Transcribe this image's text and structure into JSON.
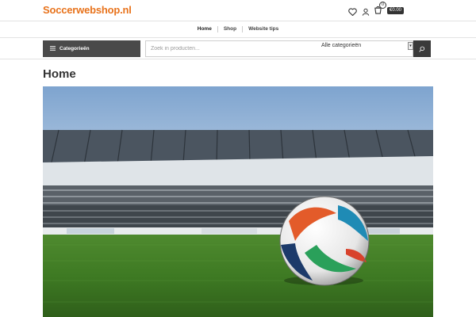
{
  "site": {
    "logo": "Soccerwebshop.nl",
    "brand_color": "#e8731c"
  },
  "header_icons": [
    "heart-icon",
    "user-icon",
    "cart-icon"
  ],
  "cart": {
    "count": "0",
    "total": "€0.00"
  },
  "menu": {
    "items": [
      {
        "label": "Home"
      },
      {
        "label": "Shop"
      },
      {
        "label": "Website tips"
      }
    ]
  },
  "categories_button": {
    "label": "Categorieën",
    "icon": "list-icon"
  },
  "search": {
    "placeholder": "Zoek in producten...",
    "category_select": "Alle categorieën",
    "icon": "search-icon"
  },
  "page": {
    "title": "Home"
  },
  "hero": {
    "image": "soccer-ball-in-stadium"
  }
}
